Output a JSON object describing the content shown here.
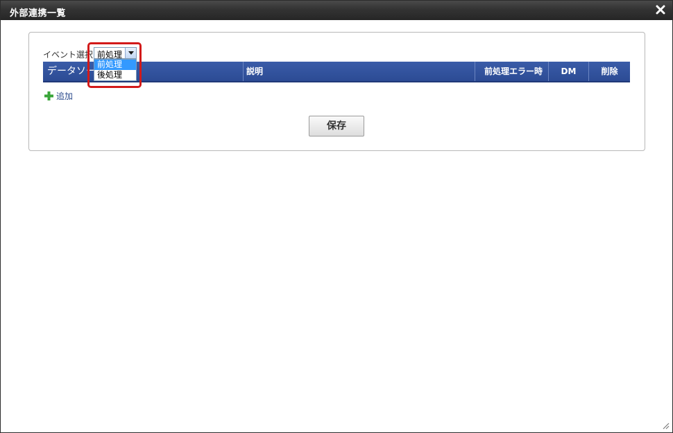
{
  "dialog": {
    "title": "外部連携一覧",
    "close_icon": "close-icon"
  },
  "event": {
    "label": "イベント選択",
    "selected": "前処理",
    "options": [
      "前処理",
      "後処理"
    ]
  },
  "table": {
    "headers": [
      "データソース",
      "説明",
      "前処理エラー時",
      "DM",
      "削除"
    ],
    "rows": []
  },
  "actions": {
    "add_label": "追加",
    "save_label": "保存"
  },
  "colors": {
    "header_bg": "#2f4f99",
    "highlight": "#d21a1a",
    "selected_option": "#3399ff",
    "add_icon": "#3aa53a"
  }
}
